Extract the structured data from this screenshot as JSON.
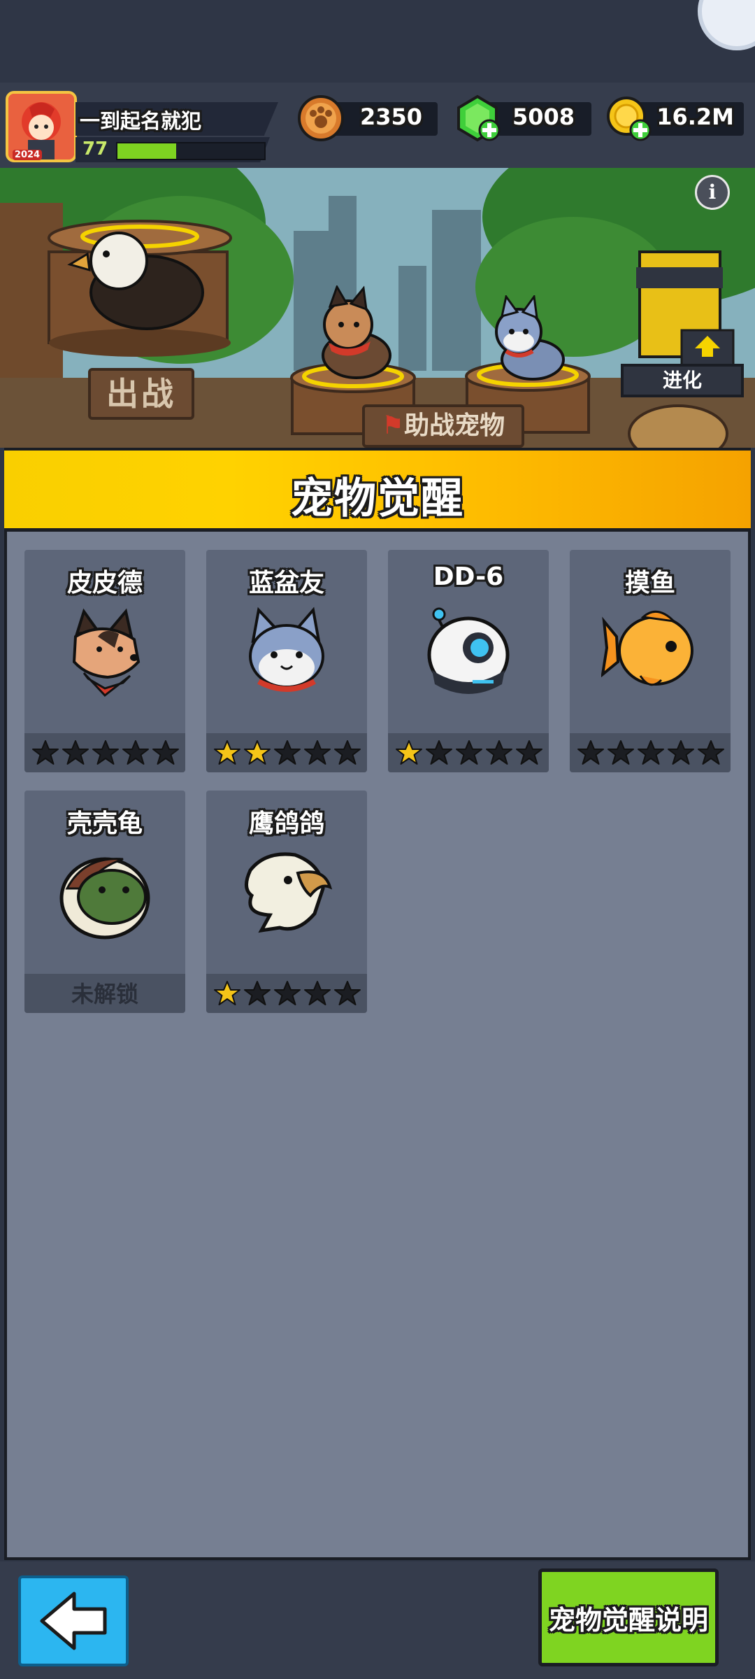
{
  "player": {
    "name": "一到起名就犯",
    "level": "77",
    "xp_fraction": 0.4,
    "avatar_year": "2024"
  },
  "resources": [
    {
      "name": "paw-coin",
      "value": "2350"
    },
    {
      "name": "gem",
      "value": "5008"
    },
    {
      "name": "gold",
      "value": "16.2M"
    }
  ],
  "scene": {
    "fight_label": "出战",
    "assist_label": "助战宠物",
    "evolve_label": "进化",
    "info_icon": "i"
  },
  "panel": {
    "title": "宠物觉醒"
  },
  "pets": [
    {
      "name": "皮皮德",
      "icon": "shepherd-dog-icon",
      "stars": 0,
      "locked": false
    },
    {
      "name": "蓝盆友",
      "icon": "husky-icon",
      "stars": 2,
      "locked": false
    },
    {
      "name": "DD-6",
      "icon": "robot-icon",
      "stars": 1,
      "locked": false
    },
    {
      "name": "摸鱼",
      "icon": "goldfish-icon",
      "stars": 0,
      "locked": false
    },
    {
      "name": "壳壳龟",
      "icon": "turtle-icon",
      "stars": 0,
      "locked": true,
      "locked_label": "未解锁"
    },
    {
      "name": "鹰鸽鸽",
      "icon": "eagle-icon",
      "stars": 1,
      "locked": false
    }
  ],
  "max_stars": 5,
  "bottom": {
    "guide_label": "宠物觉醒说明"
  },
  "colors": {
    "star_on": "#f5c518",
    "star_off": "#1b1d22",
    "banner": "#ffc400",
    "guide_button": "#7fd421",
    "back_button": "#2cb6f0"
  }
}
